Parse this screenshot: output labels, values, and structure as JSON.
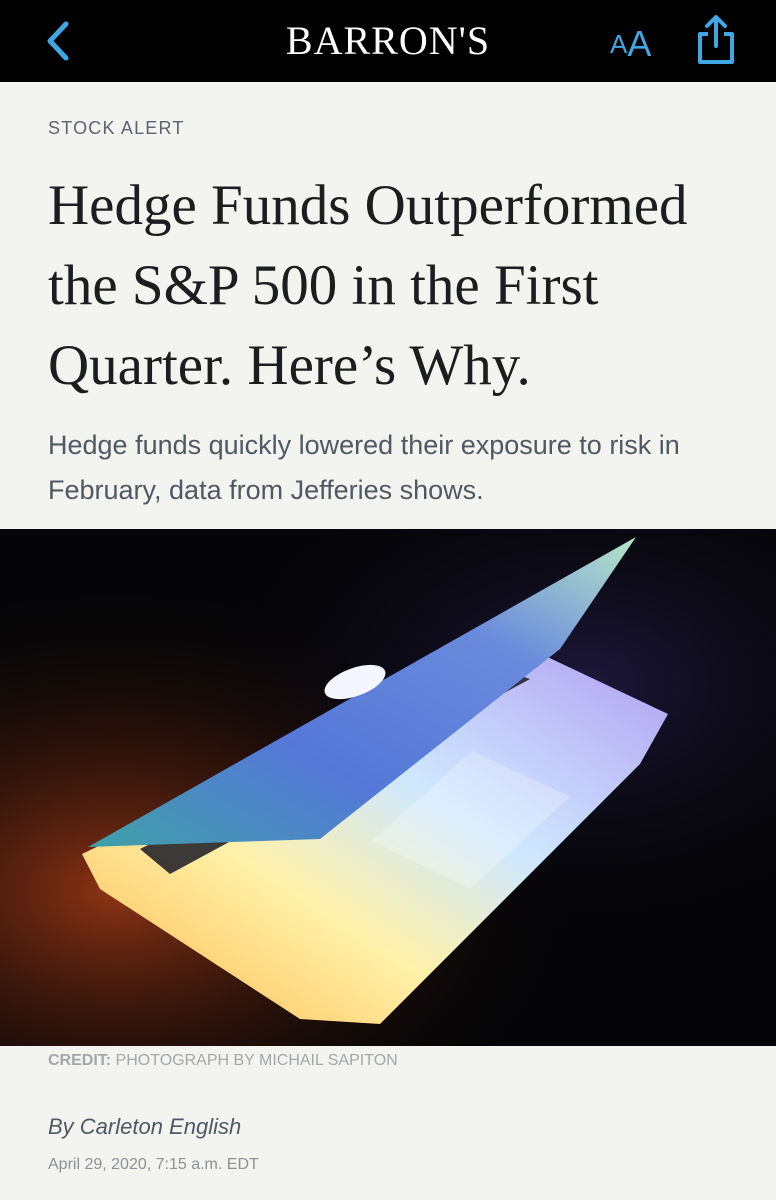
{
  "nav": {
    "back_icon": "chevron-left-icon",
    "logo": "BARRON'S",
    "text_size": {
      "small": "A",
      "big": "A"
    },
    "share_icon": "share-icon",
    "accent_color": "#3ea7e6"
  },
  "article": {
    "kicker": "STOCK ALERT",
    "headline": "Hedge Funds Outperformed the S&P 500 in the First Quarter. Here’s Why.",
    "dek": "Hedge funds quickly lowered their exposure to risk in February, data from Jefferies shows.",
    "credit_label": "CREDIT:",
    "credit_text": " PHOTOGRAPH BY MICHAIL SAPITON",
    "byline": "By Carleton English",
    "dateline": "April 29, 2020, 7:15 a.m. EDT"
  }
}
